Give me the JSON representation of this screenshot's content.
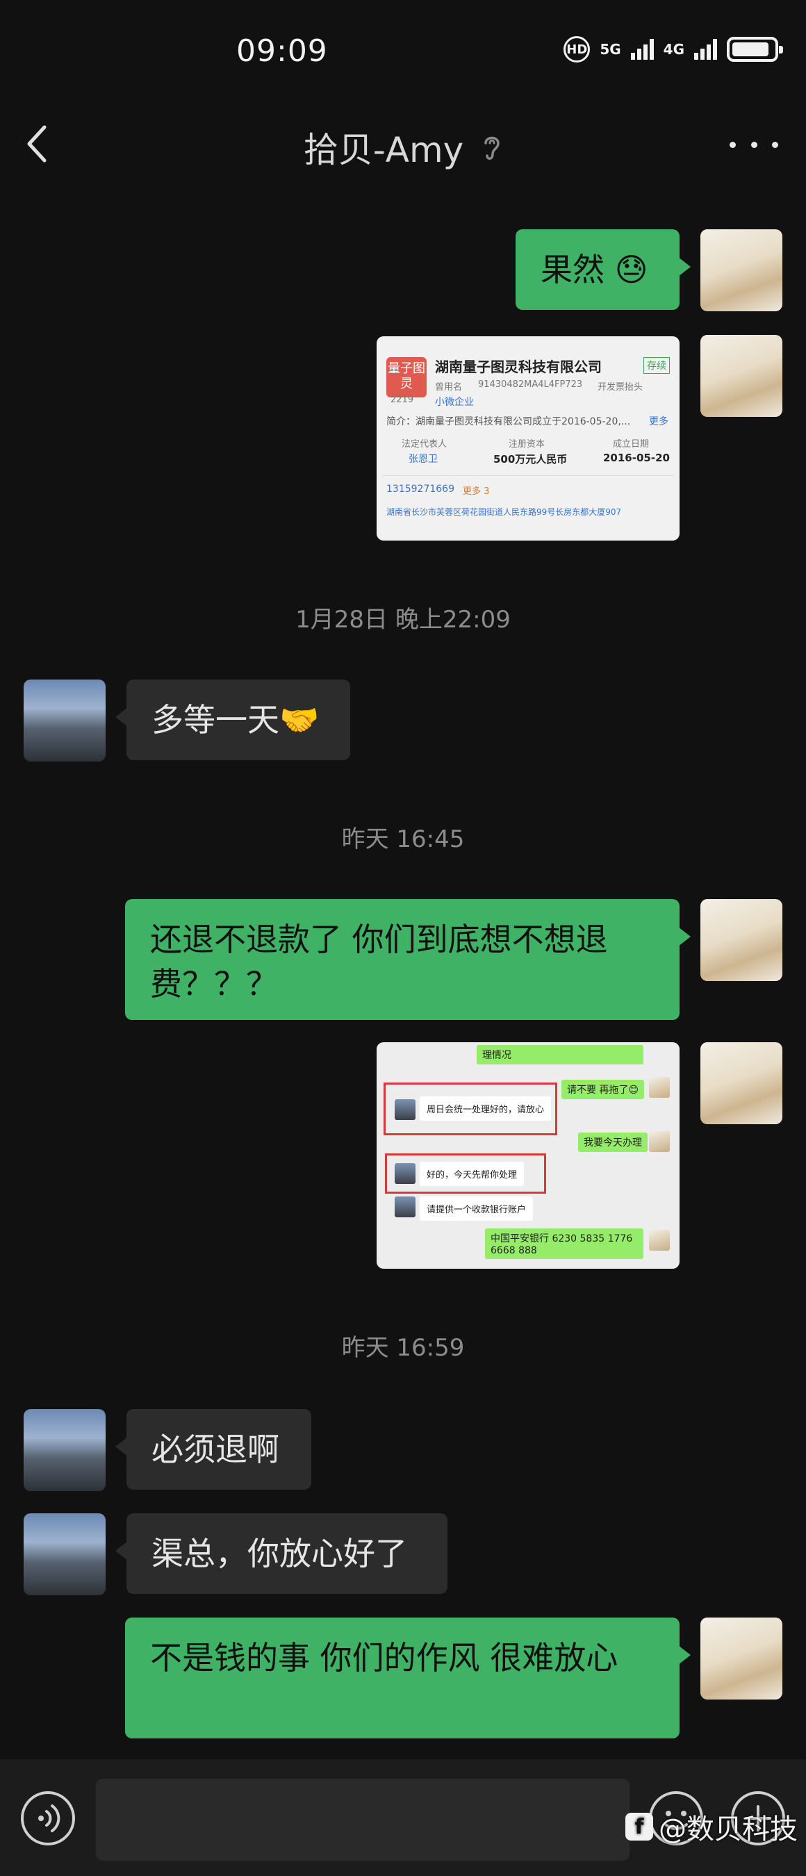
{
  "status_bar": {
    "time": "09:09",
    "hd_label": "HD",
    "net1": "5G",
    "net2": "4G"
  },
  "header": {
    "title": "拾贝-Amy"
  },
  "colors": {
    "background": "#111111",
    "bubble_me": "#3fb265",
    "bubble_them": "#2c2c2c",
    "timestamp": "#8c8c8c"
  },
  "messages": {
    "m1": "果然 😓",
    "ts1": "1月28日 晚上22:09",
    "m2": "多等一天🤝",
    "ts2": "昨天 16:45",
    "m3": "还退不退款了  你们到底想不想退费？？？",
    "ts3": "昨天 16:59",
    "m4": "必须退啊",
    "m5": "渠总，你放心好了",
    "m6": "不是钱的事   你们的作风   很难放心"
  },
  "company_card": {
    "logo": "量子图灵",
    "name": "湖南量子图灵科技有限公司",
    "status": "存续",
    "meta_a": "曾用名",
    "code": "91430482MA4L4FP723",
    "meta_b": "开发票抬头",
    "count": "2219",
    "tag": "小微企业",
    "intro": "简介：湖南量子图灵科技有限公司成立于2016-05-20,...",
    "more": "更多",
    "h1": "法定代表人",
    "h2": "注册资本",
    "h3": "成立日期",
    "v1": "张恩卫",
    "v2": "500万元人民币",
    "v3": "2016-05-20",
    "phone": "13159271669",
    "phone_more": "更多 3",
    "address": "湖南省长沙市芙蓉区荷花园街道人民东路99号长房东都大厦907"
  },
  "chat_shot": {
    "top": "理情况",
    "g1": "请不要  再拖了😊",
    "w1": "周日会统一处理好的，请放心",
    "g2": "我要今天办理",
    "w2": "好的，今天先帮你处理",
    "w3": "请提供一个收款银行账户",
    "g3": "中国平安银行 6230 5835 1776 6668 888"
  },
  "watermark": {
    "text": "@数贝科技"
  }
}
